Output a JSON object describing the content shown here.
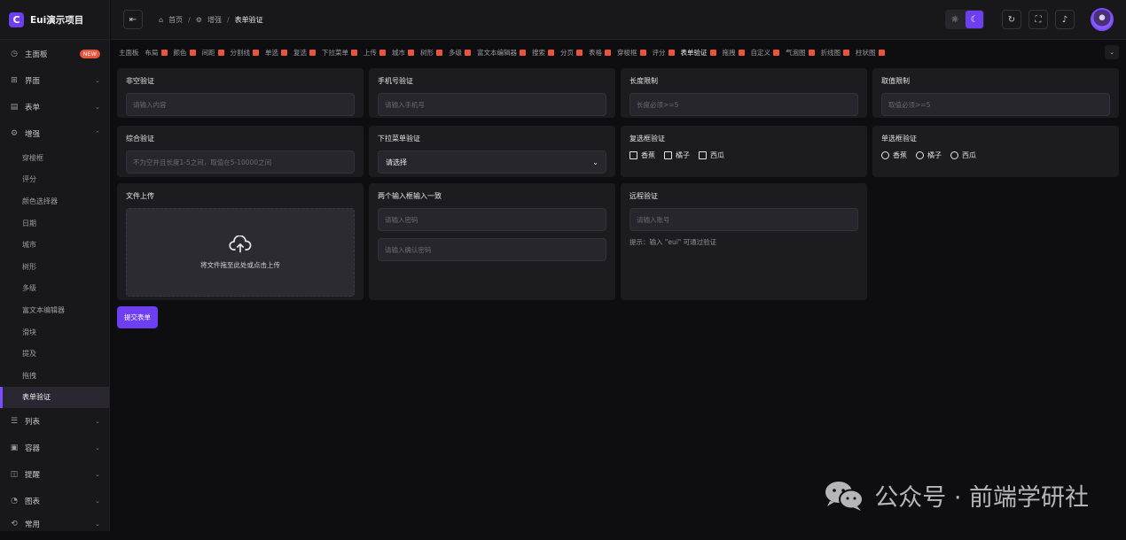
{
  "app": {
    "title": "Eui演示项目"
  },
  "sidebar": {
    "items": [
      {
        "label": "主面板",
        "icon": "dashboard-icon",
        "badge": "NEW"
      },
      {
        "label": "界面",
        "icon": "layout-icon"
      },
      {
        "label": "表单",
        "icon": "form-icon"
      },
      {
        "label": "增强",
        "icon": "enhance-icon",
        "expanded": true
      }
    ],
    "sub_items": [
      "穿梭框",
      "评分",
      "颜色选择器",
      "日期",
      "城市",
      "树形",
      "多级",
      "富文本编辑器",
      "滑块",
      "提及",
      "拖拽",
      "表单验证"
    ],
    "active_sub": "表单验证",
    "bottom_items": [
      {
        "label": "列表",
        "icon": "list-icon"
      },
      {
        "label": "容器",
        "icon": "container-icon"
      },
      {
        "label": "提醒",
        "icon": "notice-icon"
      },
      {
        "label": "图表",
        "icon": "chart-icon"
      },
      {
        "label": "常用",
        "icon": "common-icon"
      }
    ]
  },
  "header": {
    "breadcrumb": [
      "首页",
      "增强",
      "表单验证"
    ],
    "icons": [
      "collapse-icon",
      "sun-icon",
      "moon-icon",
      "refresh-icon",
      "fullscreen-icon",
      "bell-icon",
      "avatar"
    ]
  },
  "tabs": [
    "主面板",
    "布局",
    "颜色",
    "间距",
    "分割线",
    "单选",
    "复选",
    "下拉菜单",
    "上传",
    "城市",
    "树形",
    "多级",
    "富文本编辑器",
    "搜索",
    "分页",
    "表格",
    "穿梭框",
    "评分",
    "表单验证",
    "拖拽",
    "自定义",
    "气泡图",
    "折线图",
    "柱状图"
  ],
  "active_tab": "表单验证",
  "form": {
    "required": {
      "label": "非空验证",
      "placeholder": "请输入内容"
    },
    "phone": {
      "label": "手机号验证",
      "placeholder": "请输入手机号"
    },
    "length": {
      "label": "长度限制",
      "placeholder": "长度必须>=5"
    },
    "range": {
      "label": "取值限制",
      "placeholder": "取值必须>=5"
    },
    "combo": {
      "label": "综合验证",
      "placeholder": "不为空并且长度1-5之间，取值在5-10000之间"
    },
    "dropdown": {
      "label": "下拉菜单验证",
      "value": "请选择"
    },
    "checkbox": {
      "label": "复选框验证",
      "options": [
        "香蕉",
        "橘子",
        "西瓜"
      ]
    },
    "radio": {
      "label": "单选框验证",
      "options": [
        "香蕉",
        "橘子",
        "西瓜"
      ]
    },
    "upload": {
      "label": "文件上传",
      "text": "将文件拖至此处或点击上传"
    },
    "match": {
      "label": "两个输入框输入一致",
      "placeholder1": "请输入密码",
      "placeholder2": "请输入确认密码"
    },
    "remote": {
      "label": "远程验证",
      "placeholder": "请输入账号",
      "hint": "提示：输入 \"eui\" 可通过验证"
    },
    "submit": "提交表单"
  },
  "watermark": {
    "text": "公众号 · 前端学研社"
  },
  "colors": {
    "accent": "#6d3ff0",
    "tab_close": "#e9553c",
    "bg": "#0e0e10",
    "card": "#1c1c20"
  }
}
